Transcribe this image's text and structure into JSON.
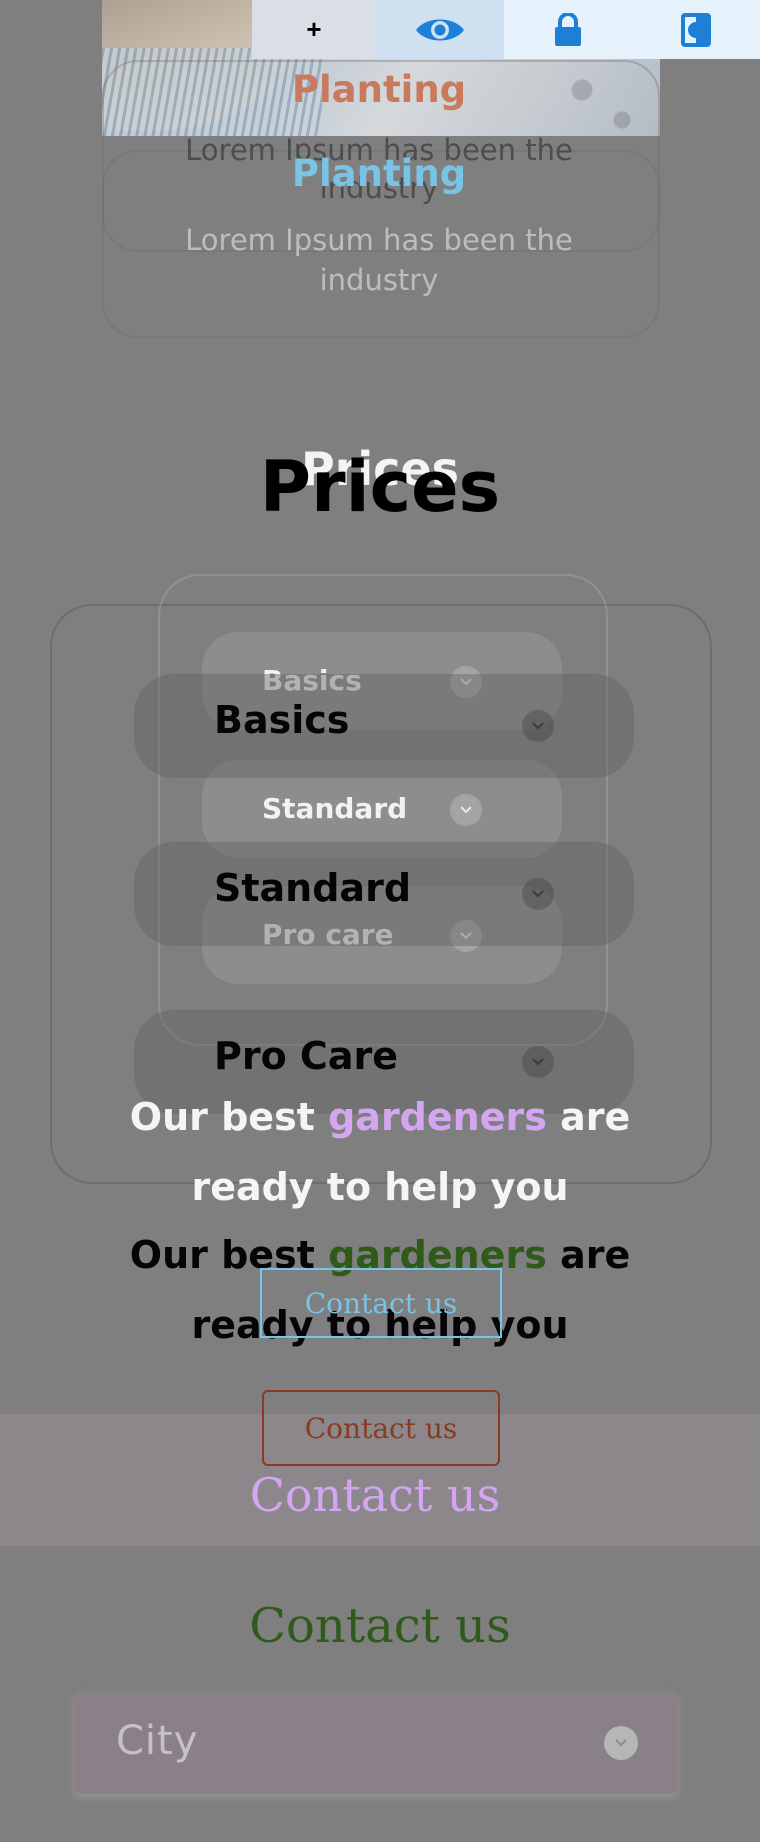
{
  "colors": {
    "overlay": "#7f7f7f",
    "planting_orange": "#c97a5d",
    "planting_blue": "#79c3e6",
    "accent_purple": "#d4a6f2",
    "accent_green": "#2f5a1a",
    "contact_brown": "#8b3a22",
    "toolbar_bg": "#e6f2fb",
    "toolbar_icon": "#1d7fd6"
  },
  "toolbar": {
    "plus_label": "+",
    "eye_icon": "eye-icon",
    "lock_icon": "lock-icon",
    "contrast_icon": "contrast-icon"
  },
  "card": {
    "title": "Planting",
    "text_line1": "Lorem Ipsum has been the",
    "text_line2": "industry"
  },
  "prices": {
    "title": "Prices",
    "items": [
      {
        "label": "Basics"
      },
      {
        "label": "Standard"
      },
      {
        "label": "Pro Care"
      }
    ],
    "ghost_items": [
      {
        "label": "Basics"
      },
      {
        "label": "Standard"
      },
      {
        "label": "Pro care"
      }
    ]
  },
  "help": {
    "prefix": "Our best",
    "highlight": "gardeners",
    "suffix": "are",
    "line2": "ready to help you"
  },
  "contact": {
    "button_label": "Contact us",
    "heading": "Contact us"
  },
  "form": {
    "city_placeholder": "City"
  }
}
